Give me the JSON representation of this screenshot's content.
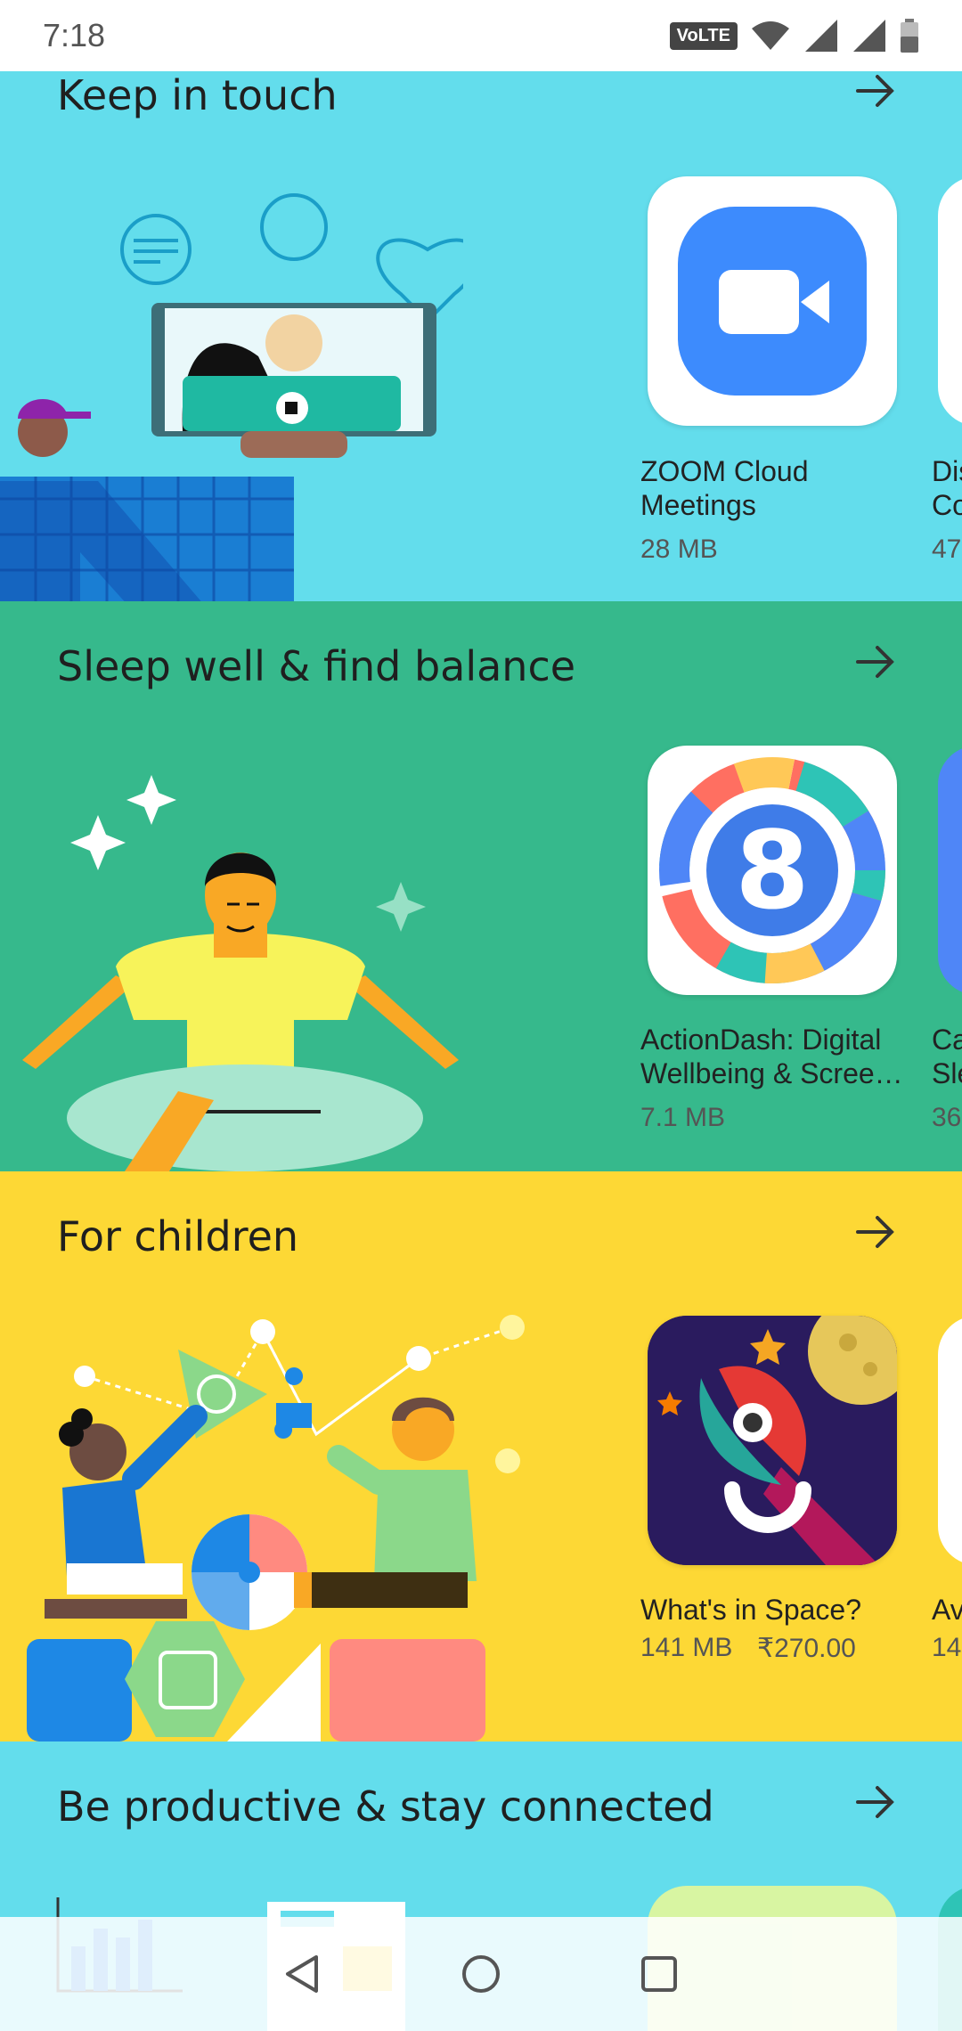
{
  "status_bar": {
    "time": "7:18",
    "volte": "VoLTE"
  },
  "sections": [
    {
      "title": "Keep in touch",
      "bg": "#63DDEC",
      "app": {
        "name_line1": "ZOOM Cloud",
        "name_line2": "Meetings",
        "meta": "28 MB"
      },
      "peek": {
        "line1": "Dis",
        "line2": "Co",
        "meta": "47"
      }
    },
    {
      "title": "Sleep well & find balance",
      "bg": "#36B98C",
      "app": {
        "name_line1": "ActionDash: Digital",
        "name_line2": "Wellbeing & Screen…",
        "meta": "7.1 MB"
      },
      "peek": {
        "line1": "Ca",
        "line2": "Sle",
        "meta": "36"
      }
    },
    {
      "title": "For children",
      "bg": "#FDD835",
      "app": {
        "name_line1": "What's in Space?",
        "size": "141 MB",
        "price": "₹270.00"
      },
      "peek": {
        "line1": "Av",
        "meta": "14"
      }
    },
    {
      "title": "Be productive & stay connected",
      "bg": "#63DDEC"
    }
  ],
  "nav": {
    "back": "back-icon",
    "home": "home-icon",
    "recents": "recents-icon"
  }
}
